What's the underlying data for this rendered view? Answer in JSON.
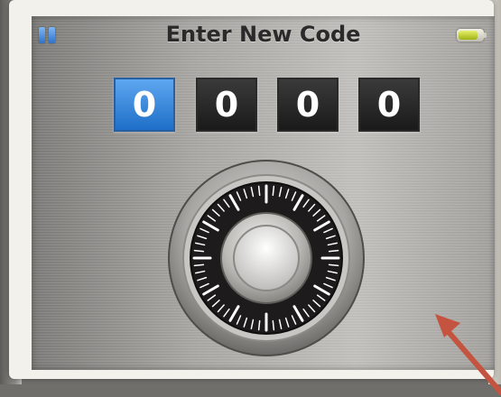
{
  "header": {
    "title": "Enter New Code",
    "left_icon": "pause-icon",
    "right_icon": "battery-icon",
    "battery_level": 0.8
  },
  "code": {
    "digits": [
      "0",
      "0",
      "0",
      "0"
    ],
    "active_index": 0,
    "active_color": "#2f82d8"
  },
  "dial": {
    "icon": "combination-dial-icon"
  },
  "annotation": {
    "icon": "red-arrow-icon",
    "color": "#c4533f"
  }
}
